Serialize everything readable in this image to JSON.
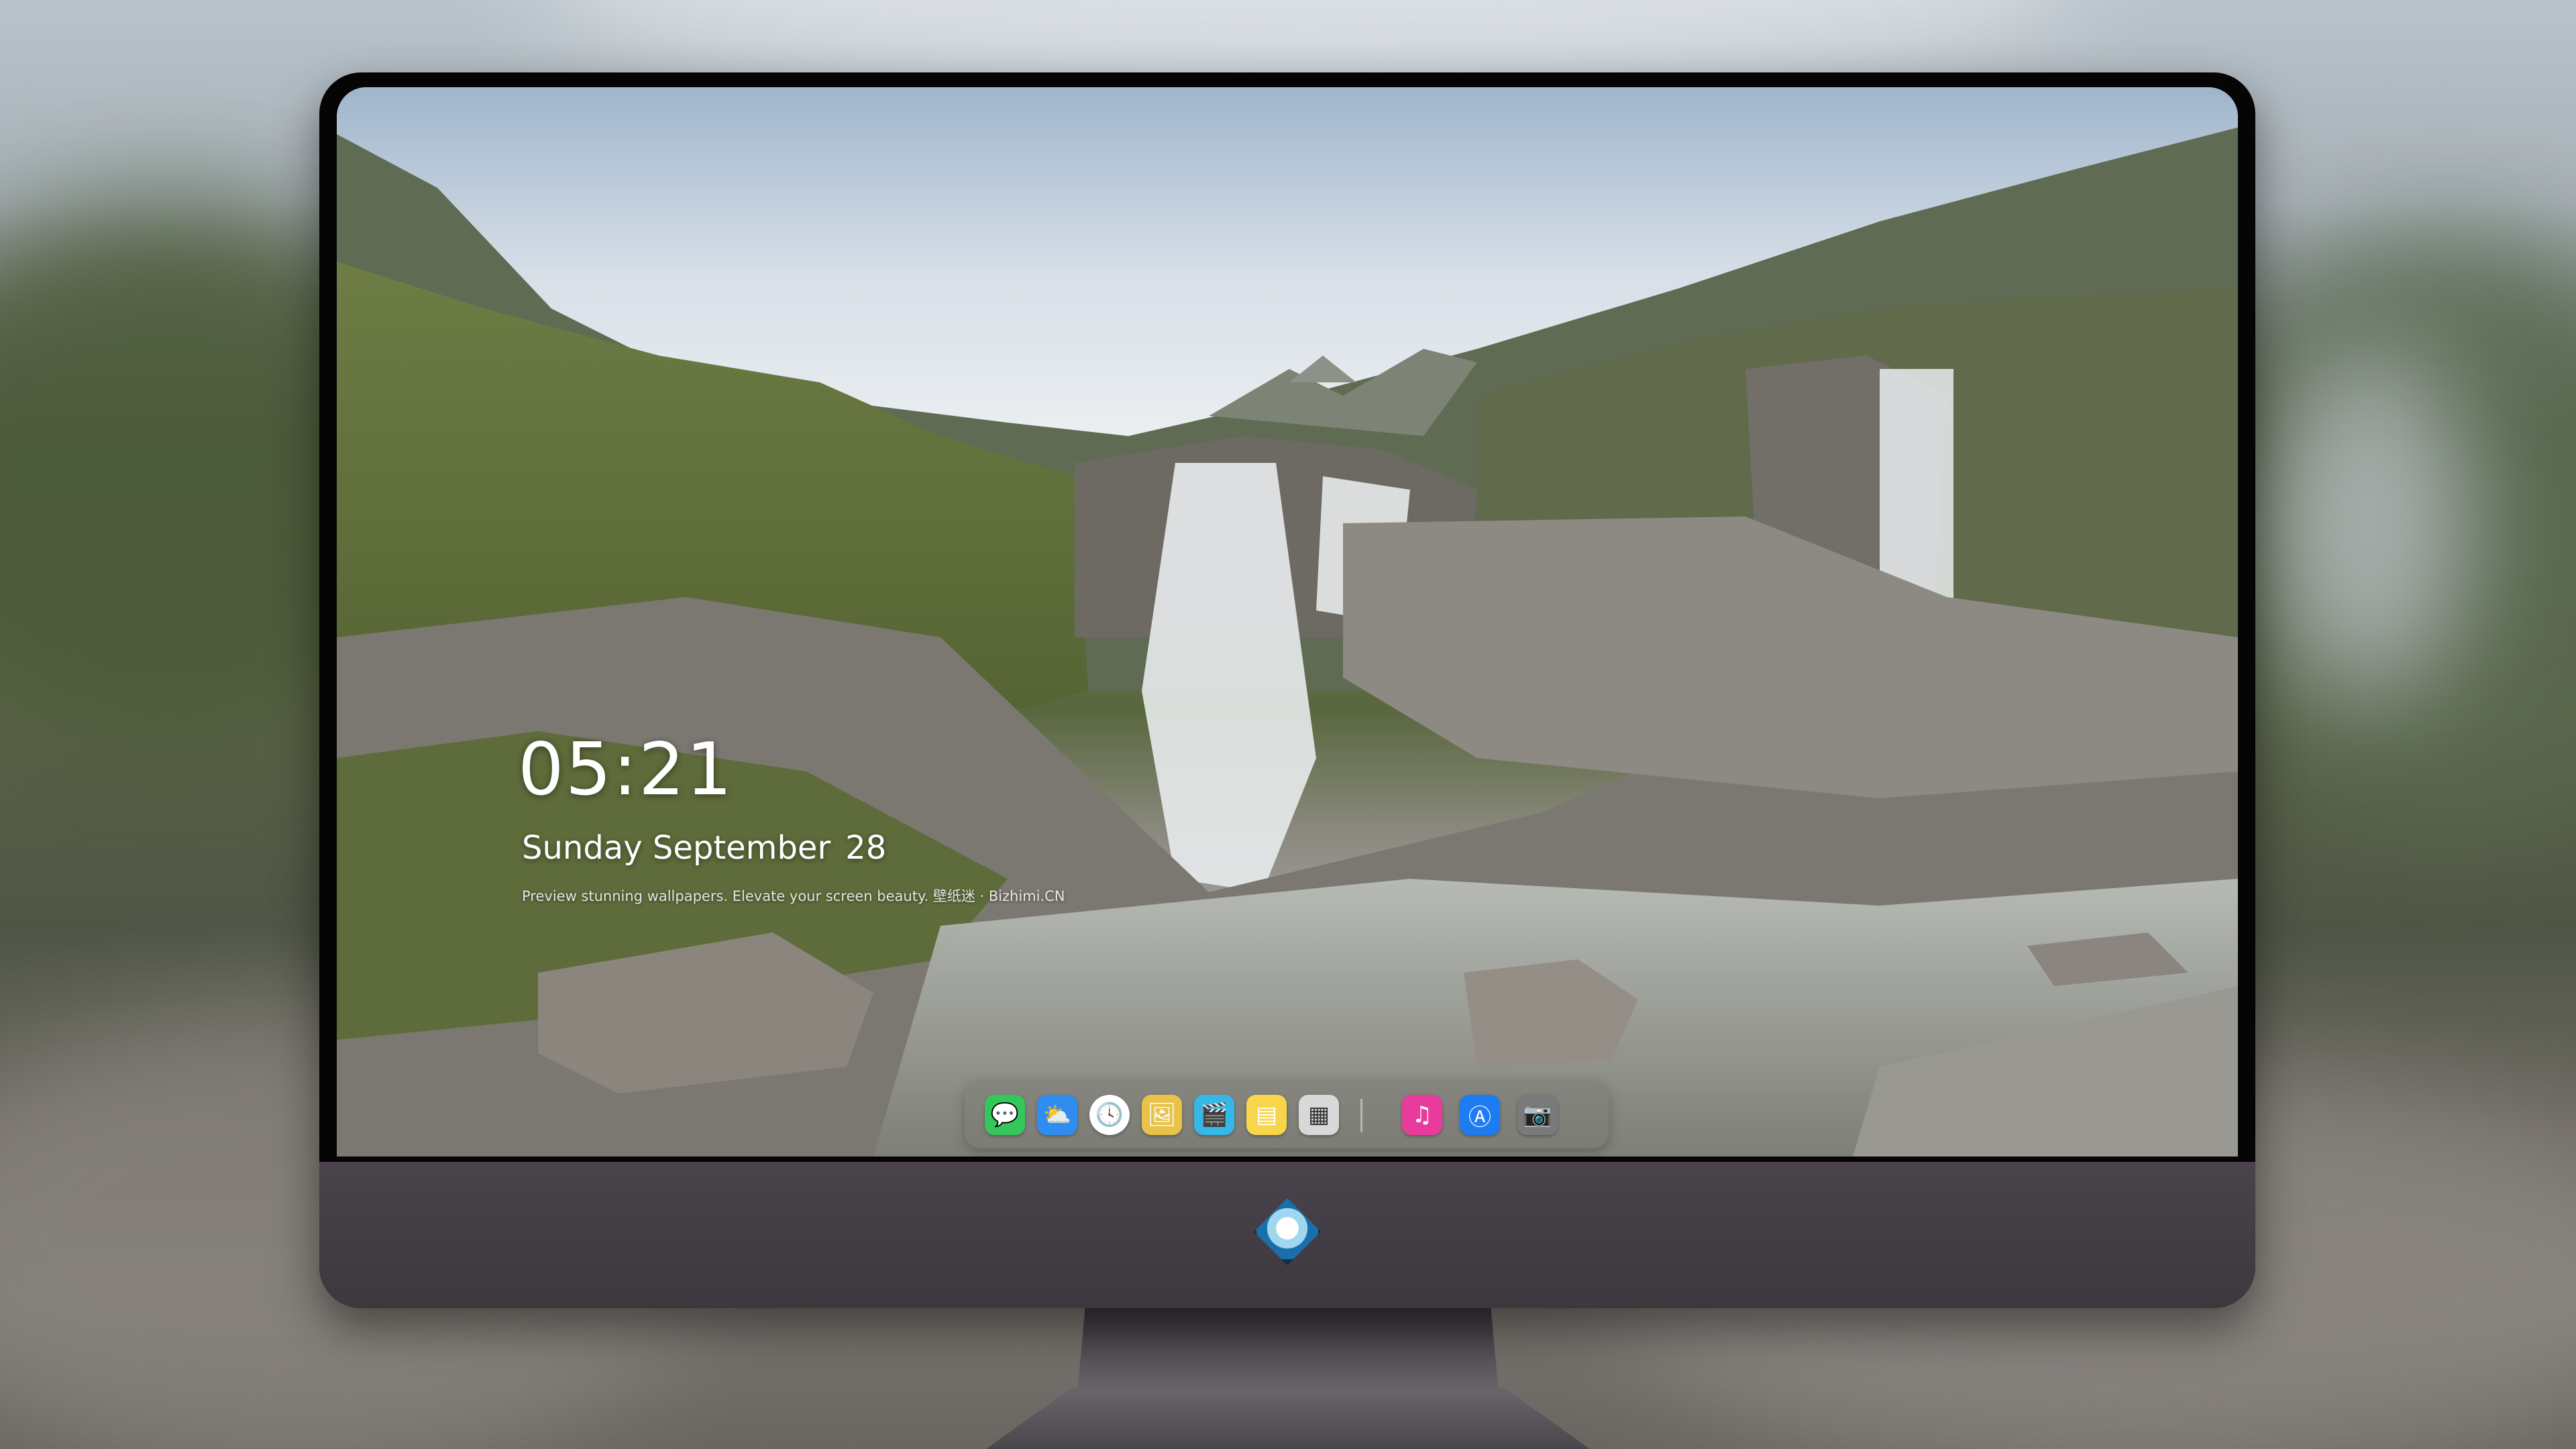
{
  "lockscreen": {
    "time": "05:21",
    "date_text": "Sunday September",
    "day": "28",
    "tagline": "Preview stunning wallpapers. Elevate your screen beauty. 壁纸迷 · Bizhimi.CN"
  },
  "dock": {
    "apps": [
      {
        "name": "messages",
        "icon": "speech-bubble-icon",
        "color": "#34c759"
      },
      {
        "name": "weather",
        "icon": "cloud-sun-icon",
        "color": "#2f8df0"
      },
      {
        "name": "clock",
        "icon": "clock-icon",
        "color": "#ffffff"
      },
      {
        "name": "preview",
        "icon": "photo-viewer-icon",
        "color": "#e9c24a"
      },
      {
        "name": "video",
        "icon": "clapperboard-icon",
        "color": "#35b8e6"
      },
      {
        "name": "notes",
        "icon": "note-icon",
        "color": "#f7d64a"
      },
      {
        "name": "photo-booth",
        "icon": "photo-stack-icon",
        "color": "#d8d8d8"
      }
    ],
    "apps_right": [
      {
        "name": "music",
        "icon": "music-note-icon",
        "color": "#e83b9c"
      },
      {
        "name": "app-store",
        "icon": "app-store-icon",
        "color": "#1e7cf2"
      },
      {
        "name": "camera",
        "icon": "camera-icon",
        "color": "#7a7a7a"
      }
    ]
  },
  "colors": {
    "bezel": "#050506",
    "chin": "#423c43",
    "dock_bg": "#78766f"
  }
}
